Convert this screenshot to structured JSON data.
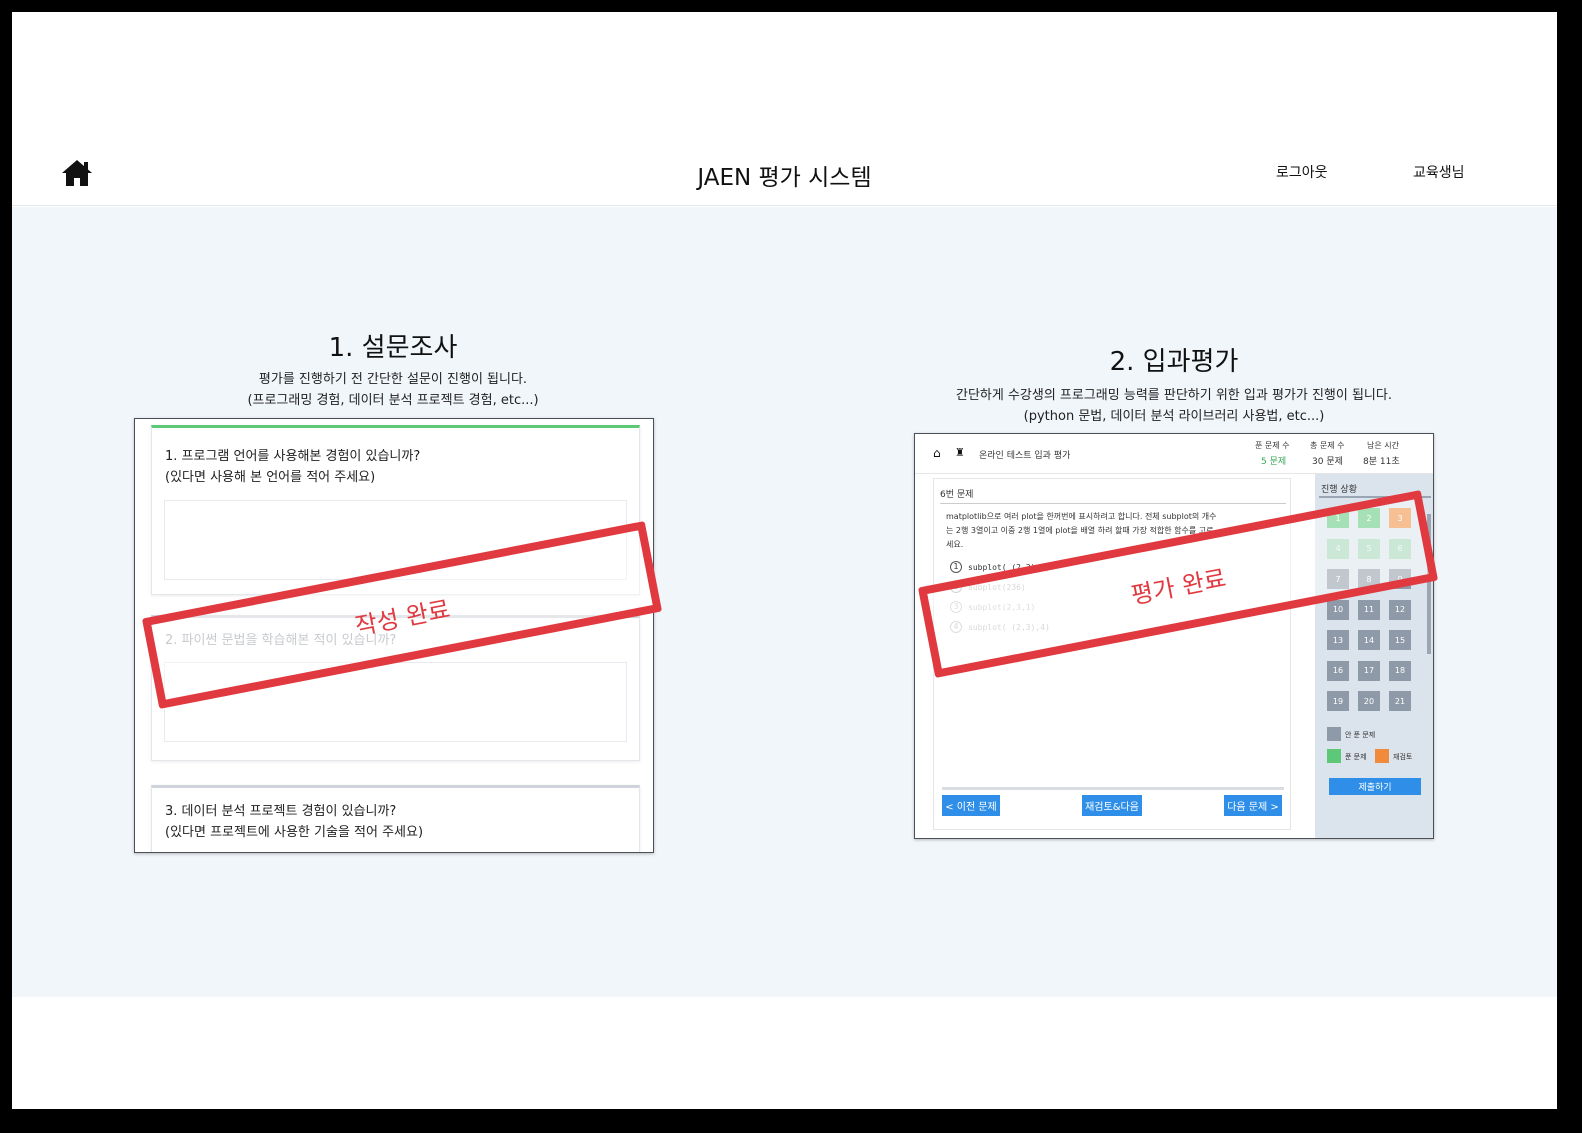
{
  "header": {
    "title": "JAEN 평가 시스템",
    "logout": "로그아웃",
    "user": "교육생님"
  },
  "survey_card": {
    "title": "1. 설문조사",
    "desc_line1": "평가를 진행하기 전 간단한 설문이 진행이 됩니다.",
    "desc_line2": "(프로그래밍 경험, 데이터 분석 프로젝트 경험, etc...)",
    "q1_line1": "1. 프로그램 언어를 사용해본 경험이 있습니까?",
    "q1_line2": "(있다면 사용해 본 언어를 적어 주세요)",
    "q2_line1": "2. 파이썬 문법을 학습해본 적이 있습니까?",
    "q3_line1": "3. 데이터 분석 프로젝트 경험이 있습니까?",
    "q3_line2": "(있다면 프로젝트에 사용한 기술을 적어 주세요)",
    "stamp": "작성 완료"
  },
  "eval_card": {
    "title": "2. 입과평가",
    "desc_line1": "간단하게 수강생의 프로그래밍 능력를 판단하기 위한 입과 평가가 진행이 됩니다.",
    "desc_line2": "(python 문법, 데이터 분석 라이브러리 사용법, etc...)",
    "stamp": "평가 완료",
    "preview": {
      "breadcrumb": "온라인 테스트  입과 평가",
      "solved_label": "푼 문제 수",
      "solved_value": "5 문제",
      "total_label": "총 문제 수",
      "total_value": "30 문제",
      "time_label": "남은 시간",
      "time_value": "8분 11초",
      "question_no": "6번 문제",
      "question_line1": "matplotlib으로 여러 plot을 한꺼번에 표시하려고 합니다. 전체 subplot의 개수",
      "question_line2": "는 2행 3열이고 이중 2행 1열에 plot을 배열 하려 할때 가장 적합한 함수를 고르",
      "question_line3": "세요.",
      "options": [
        {
          "no": "1",
          "code": "subplot( (2,3),1)"
        },
        {
          "no": "2",
          "code": "subplot(236)"
        },
        {
          "no": "3",
          "code": "subplot(2,3,1)"
        },
        {
          "no": "4",
          "code": "subplot( (2,3),4)"
        }
      ],
      "prev_btn": "< 이전 문제",
      "review_btn": "재검토&다음",
      "next_btn": "다음 문제 >",
      "progress_title": "진행 상황",
      "grid": [
        "1",
        "2",
        "3",
        "4",
        "5",
        "6",
        "7",
        "8",
        "9",
        "10",
        "11",
        "12",
        "13",
        "14",
        "15",
        "16",
        "17",
        "18",
        "19",
        "20",
        "21"
      ],
      "legend_unsolved": "안 푼 문제",
      "legend_solved": "푼 문제",
      "legend_review": "재검토",
      "submit_btn": "제출하기"
    }
  },
  "colors": {
    "accent_red": "#e03a40",
    "solved_green": "#5dc878",
    "review_orange": "#f08a3c",
    "button_blue": "#2f8fe8",
    "page_bg": "#f1f6fa"
  }
}
